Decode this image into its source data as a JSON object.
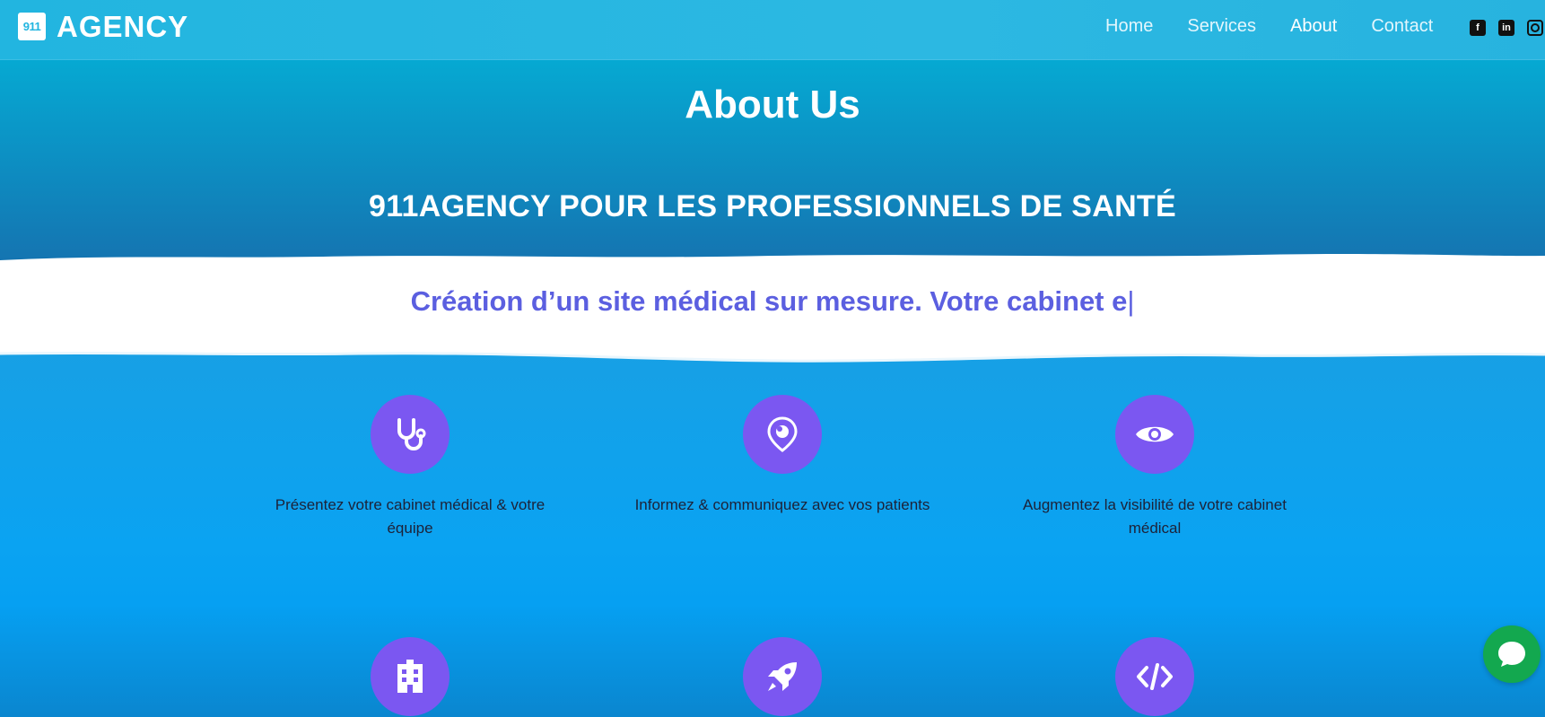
{
  "brand": {
    "logo_mark": "911",
    "logo_text": "AGENCY"
  },
  "nav": {
    "items": [
      {
        "label": "Home",
        "active": false
      },
      {
        "label": "Services",
        "active": false
      },
      {
        "label": "About",
        "active": true
      },
      {
        "label": "Contact",
        "active": false
      }
    ],
    "socials": [
      "facebook-icon",
      "linkedin-icon",
      "instagram-icon"
    ]
  },
  "hero": {
    "title": "About Us",
    "subtitle": "911AGENCY POUR LES PROFESSIONNELS DE SANTÉ"
  },
  "tagline": {
    "text": "Création d’un site médical sur mesure. Votre cabinet e",
    "cursor": "|"
  },
  "features": [
    {
      "icon": "stethoscope-icon",
      "text": "Présentez votre cabinet médical & votre équipe"
    },
    {
      "icon": "location-pin-icon",
      "text": "Informez & communiquez avec vos patients"
    },
    {
      "icon": "eye-icon",
      "text": "Augmentez la visibilité de votre cabinet médical"
    },
    {
      "icon": "hospital-icon",
      "text": ""
    },
    {
      "icon": "rocket-icon",
      "text": ""
    },
    {
      "icon": "code-icon",
      "text": ""
    }
  ],
  "colors": {
    "nav_bg": "#22b5e0",
    "accent_purple": "#7b57f1",
    "tagline": "#5b5fe0",
    "chat": "#13a84f"
  },
  "chat": {
    "icon": "chat-bubble-icon"
  }
}
